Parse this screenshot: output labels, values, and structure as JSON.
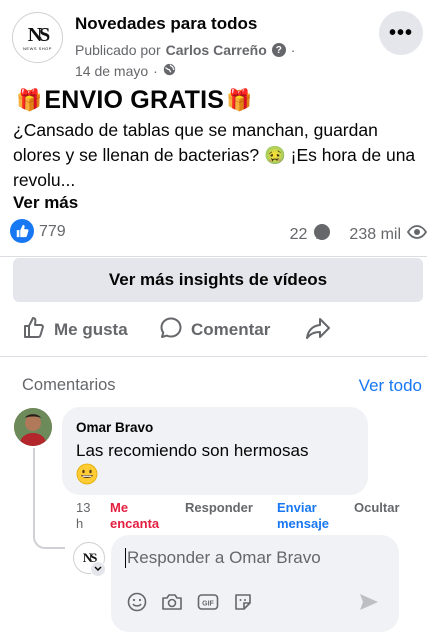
{
  "post": {
    "page_name": "Novedades para todos",
    "page_logo": {
      "monogram": "NS",
      "subtitle": "NEWS SHOP"
    },
    "published_prefix": "Publicado por",
    "author": "Carlos Carreño",
    "dot": "·",
    "date": "14 de mayo",
    "title": "ENVIO GRATIS",
    "text": "¿Cansado de tablas que se manchan, guardan olores y se llenan de bacterias? 🤢 ¡Es hora de una revolu...",
    "see_more": "Ver más"
  },
  "stats": {
    "likes": "779",
    "comments": "22",
    "views": "238 mil"
  },
  "insights_button": "Ver más insights de vídeos",
  "actions": {
    "like": "Me gusta",
    "comment": "Comentar"
  },
  "comments_section": {
    "label": "Comentarios",
    "see_all": "Ver todo",
    "comment": {
      "author": "Omar Bravo",
      "text": "Las recomiendo son hermosas",
      "emoji": "😀",
      "time_num": "13",
      "time_unit": "h",
      "reaction_line1": "Me",
      "reaction_line2": "encanta",
      "reply": "Responder",
      "send_line1": "Enviar",
      "send_line2": "mensaje",
      "hide": "Ocultar"
    },
    "reply_placeholder": "Responder a Omar Bravo"
  },
  "colors": {
    "accent": "#1877f2",
    "love": "#e41e3f",
    "secondary_text": "#65676b",
    "button_bg": "#e4e6eb",
    "bubble_bg": "#f0f2f5"
  }
}
